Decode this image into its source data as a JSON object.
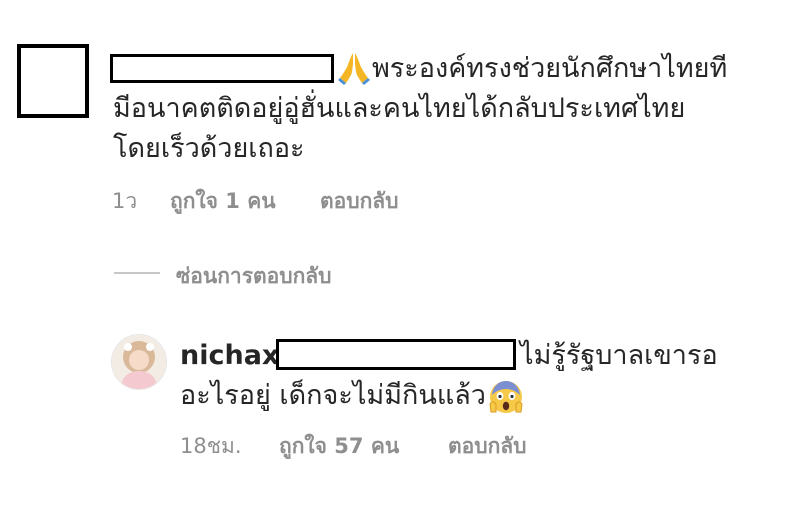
{
  "comment": {
    "text_line1": "พระองค์ทรงช่วยนักศึกษาไทยที",
    "text_line2": "มีอนาคตติดอยู่อู่ฮั่นและคนไทยได้กลับประเทศไทย",
    "text_line3": "โดยเร็วด้วยเถอะ",
    "emoji": "folded-hands",
    "time": "1ว",
    "likes": "ถูกใจ 1 คน",
    "reply": "ตอบกลับ"
  },
  "hide_replies": "ซ่อนการตอบกลับ",
  "reply_comment": {
    "username": "nichax",
    "text_line1": "ไม่รู้รัฐบาลเขารอ",
    "text_line2": "อะไรอยู่ เด็กจะไม่มีกินแล้ว",
    "emoji": "face-screaming-in-fear",
    "time": "18ชม.",
    "likes": "ถูกใจ 57 คน",
    "reply": "ตอบกลับ"
  },
  "colors": {
    "text": "#262626",
    "meta": "#8e8e8e"
  }
}
